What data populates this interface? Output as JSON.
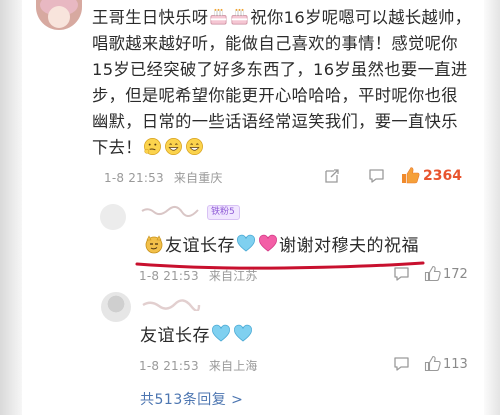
{
  "comment": {
    "text_part1": "王哥生日快乐呀",
    "text_part2": "祝你16岁呢嗯可以越长越帅，唱歌越来越好听，能做自己喜欢的事情！感觉呢你15岁已经突破了好多东西了，16岁虽然也要一直进步，但是呢希望你能更开心哈哈哈，平时呢你也很幽默，日常的一些话语经常逗笑我们，要一直快乐下去！",
    "time": "1-8 21:53",
    "location": "来自重庆",
    "like_count": "2364",
    "icons": [
      "cake-emoji",
      "cake-emoji",
      "thinking-emoji",
      "grin-emoji",
      "grin-emoji",
      "share-icon",
      "comment-icon",
      "like-icon"
    ]
  },
  "replies": [
    {
      "fan_badge": "铁粉5",
      "text_part1": "友谊长存",
      "text_part2": "谢谢对穆夫的祝福",
      "time": "1-8 21:53",
      "location": "来自江苏",
      "like_count": "172",
      "icons": [
        "smirk-emoji",
        "blue-heart-emoji",
        "pink-heart-emoji"
      ]
    },
    {
      "text": "友谊长存",
      "time": "1-8 21:53",
      "location": "来自上海",
      "like_count": "113",
      "icons": [
        "blue-heart-emoji",
        "blue-heart-emoji"
      ]
    }
  ],
  "total_replies_link": "共513条回复 >",
  "colors": {
    "accent_like": "#e8542e",
    "link": "#4d76b1",
    "underline_annotation": "#c8102e",
    "fan_badge": "#8f5bd6"
  }
}
